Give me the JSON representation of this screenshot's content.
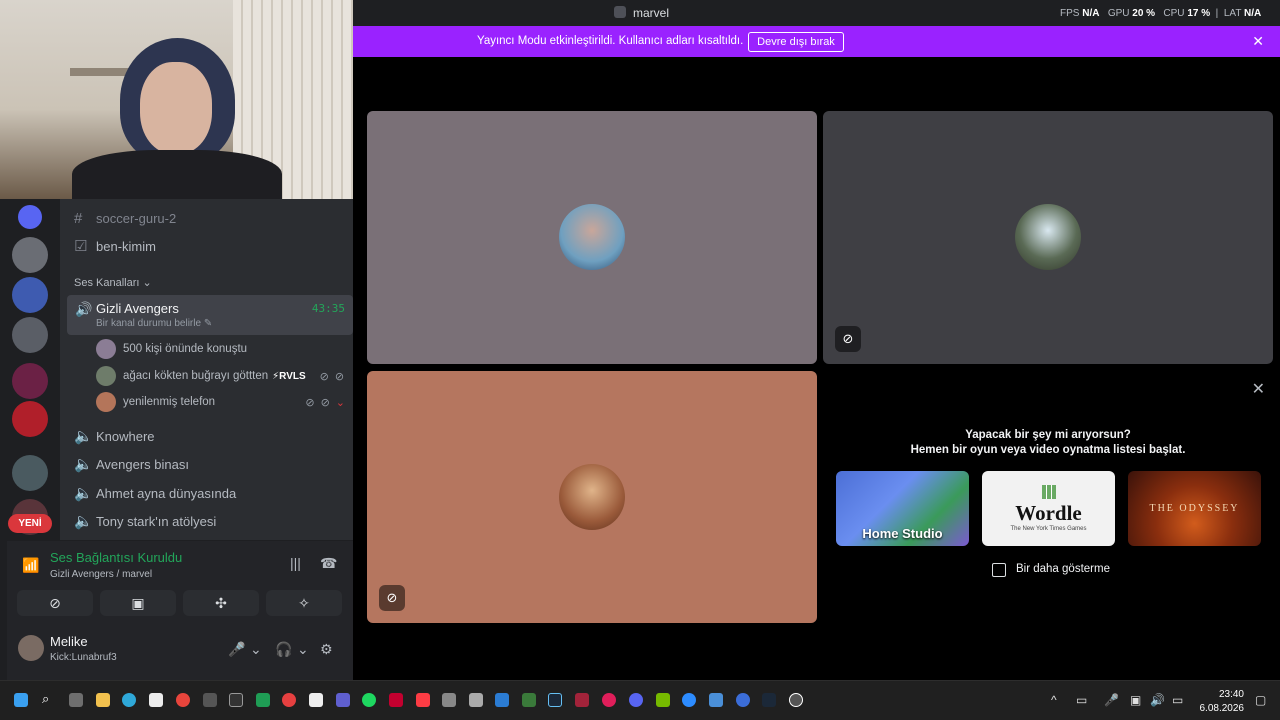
{
  "window": {
    "title": "marvel"
  },
  "stats": {
    "fps_label": "FPS",
    "fps_value": "N/A",
    "gpu_label": "GPU",
    "gpu_value": "20 %",
    "cpu_label": "CPU",
    "cpu_value": "17 %",
    "lat_label": "LAT",
    "lat_value": "N/A"
  },
  "banner": {
    "message": "Yayıncı Modu etkinleştirildi. Kullanıcı adları kısaltıldı.",
    "button_label": "Devre dışı bırak",
    "close_icon": "close-icon",
    "color": "#9a22ff"
  },
  "server_badge": {
    "label": "YENİ"
  },
  "channels": {
    "text": [
      {
        "name": "soccer-guru-2"
      },
      {
        "name": "ben-kimim"
      }
    ],
    "voice_section_title": "Ses Kanalları",
    "active_voice": {
      "name": "Gizli Avengers",
      "timer": "43:35",
      "status_placeholder": "Bir kanal durumu belirle"
    },
    "members": [
      {
        "name": "500 kişi önünde konuştu"
      },
      {
        "name": "ağacı kökten buğrayı göttten",
        "badge": "⚡RVLS"
      },
      {
        "name": "yenilenmiş telefon"
      }
    ],
    "voice_others": [
      {
        "name": "Knowhere"
      },
      {
        "name": "Avengers binası"
      },
      {
        "name": "Ahmet ayna dünyasında"
      },
      {
        "name": "Tony stark'ın atölyesi"
      }
    ]
  },
  "voice_status": {
    "title": "Ses Bağlantısı Kuruldu",
    "subtitle": "Gizli Avengers / marvel"
  },
  "user": {
    "name": "Melike",
    "status": "Kick:Lunabruf3"
  },
  "activity": {
    "question": "Yapacak bir şey mi arıyorsun?",
    "prompt": "Hemen bir oyun veya video oynatma listesi başlat.",
    "cards": [
      {
        "label": "Home Studio"
      },
      {
        "label": "Wordle",
        "by": "The New York Times Games"
      },
      {
        "label": "THE ODYSSEY"
      }
    ],
    "checkbox_label": "Bir daha gösterme"
  },
  "clock": {
    "time": "23:40",
    "date": "6.08.2026"
  }
}
